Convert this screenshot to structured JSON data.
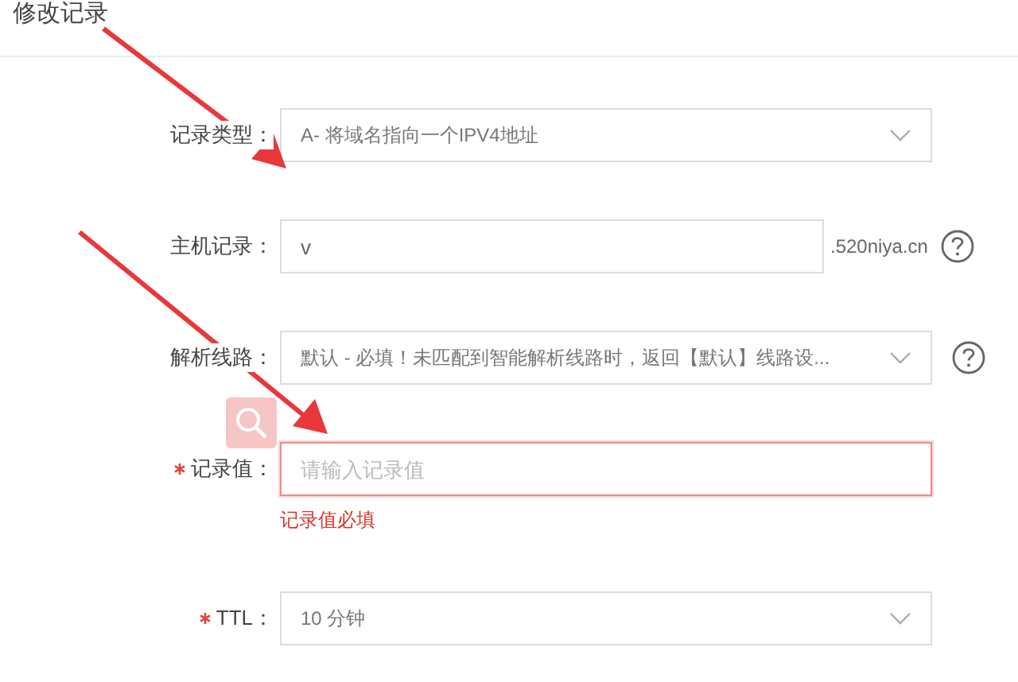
{
  "title": "修改记录",
  "fields": [
    {
      "kind": "select",
      "label": "记录类型：",
      "required": false,
      "value": "A- 将域名指向一个IPV4地址",
      "help": false,
      "error": false
    },
    {
      "kind": "input",
      "label": "主机记录：",
      "required": false,
      "value": "v",
      "suffix": ".520niya.cn",
      "help": true,
      "error": false
    },
    {
      "kind": "select",
      "label": "解析线路：",
      "required": false,
      "value": "默认 - 必填！未匹配到智能解析线路时，返回【默认】线路设...",
      "help": true,
      "error": false
    },
    {
      "kind": "input",
      "label": "记录值：",
      "required": true,
      "placeholder": "请输入记录值",
      "help": false,
      "error": true,
      "message": "记录值必填"
    },
    {
      "kind": "select",
      "label": "TTL：",
      "required": true,
      "value": "10 分钟",
      "help": false,
      "error": false
    }
  ]
}
